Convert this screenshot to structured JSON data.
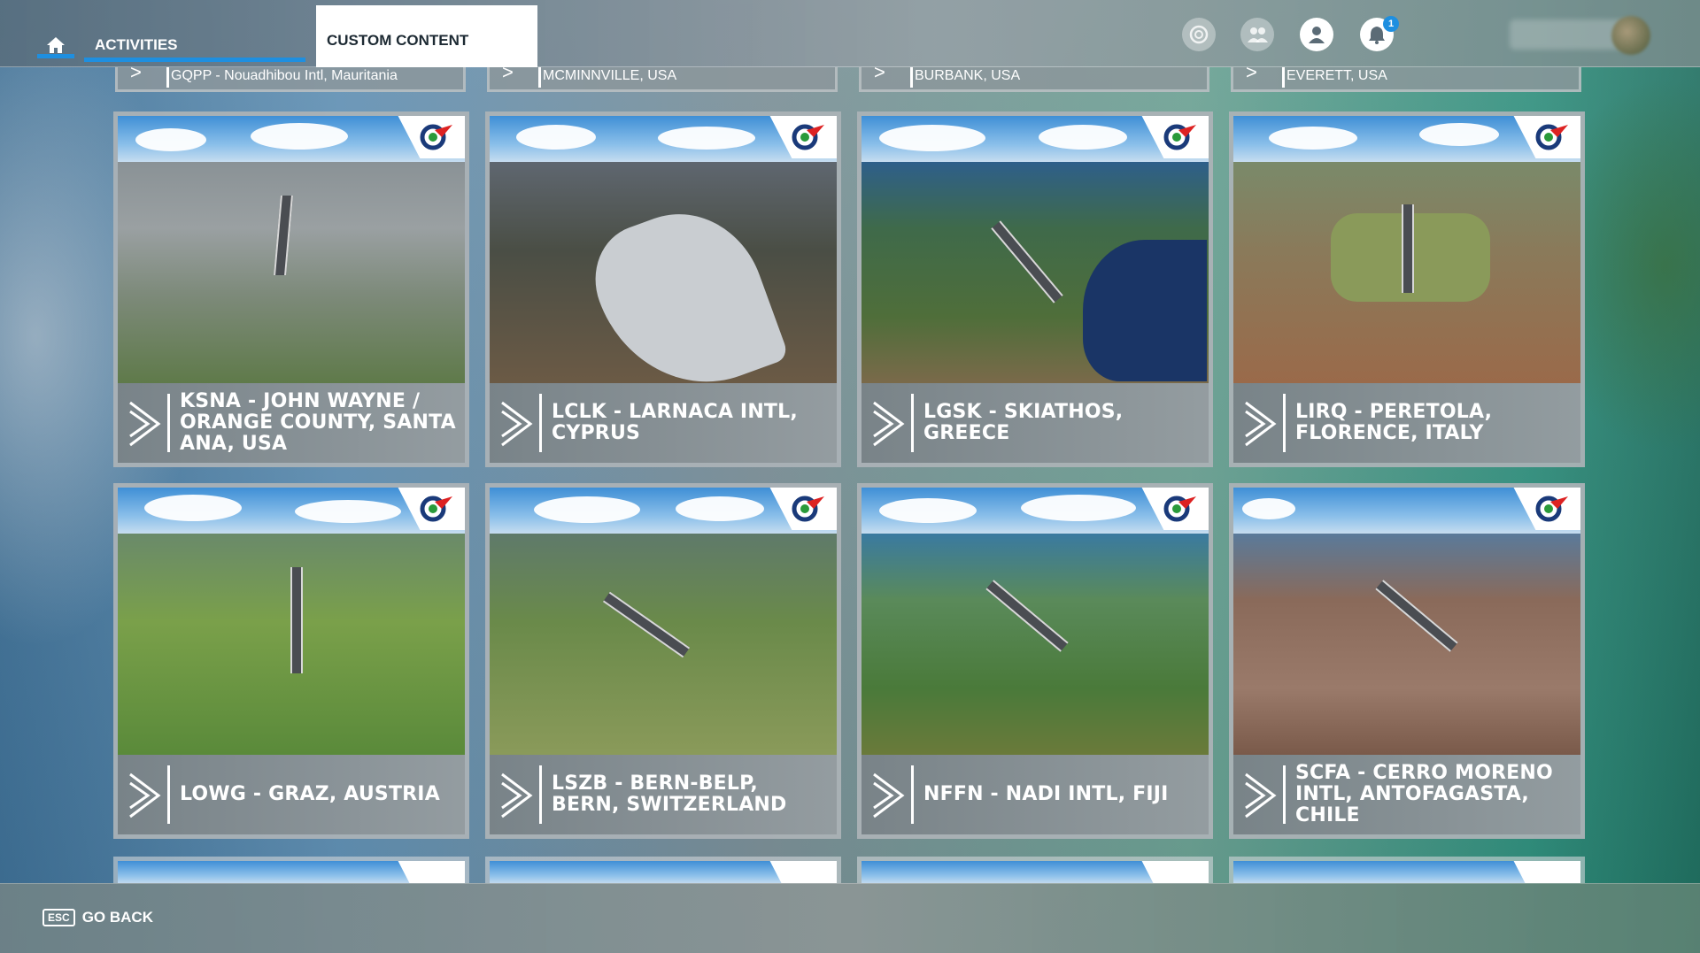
{
  "topbar": {
    "tabs": [
      {
        "label": "ACTIVITIES"
      },
      {
        "label": "CUSTOM CONTENT"
      }
    ],
    "notification_count": "1"
  },
  "colors": {
    "accent": "#1e8fe0",
    "card_text": "#ffffff",
    "active_tab_bg": "#ffffff"
  },
  "partial_top_row": [
    {
      "label": "GQPP - Nouadhibou Intl, Mauritania"
    },
    {
      "label": "MCMINNVILLE, USA"
    },
    {
      "label": "BURBANK, USA"
    },
    {
      "label": "EVERETT, USA"
    }
  ],
  "airports": [
    {
      "title": "KSNA - JOHN WAYNE / ORANGE COUNTY, SANTA ANA, USA"
    },
    {
      "title": "LCLK - LARNACA INTL, CYPRUS"
    },
    {
      "title": "LGSK - SKIATHOS, GREECE"
    },
    {
      "title": "LIRQ - PERETOLA, FLORENCE, ITALY"
    },
    {
      "title": "LOWG - GRAZ, AUSTRIA"
    },
    {
      "title": "LSZB - BERN-BELP, BERN, SWITZERLAND"
    },
    {
      "title": "NFFN - NADI INTL, FIJI"
    },
    {
      "title": "SCFA - CERRO MORENO INTL, ANTOFAGASTA, CHILE"
    }
  ],
  "footer": {
    "key": "ESC",
    "label": "GO BACK"
  },
  "icons": [
    "home-icon",
    "achievements-icon",
    "friends-icon",
    "profile-icon",
    "bell-icon",
    "chevron-right-icon",
    "publisher-logo-icon"
  ]
}
